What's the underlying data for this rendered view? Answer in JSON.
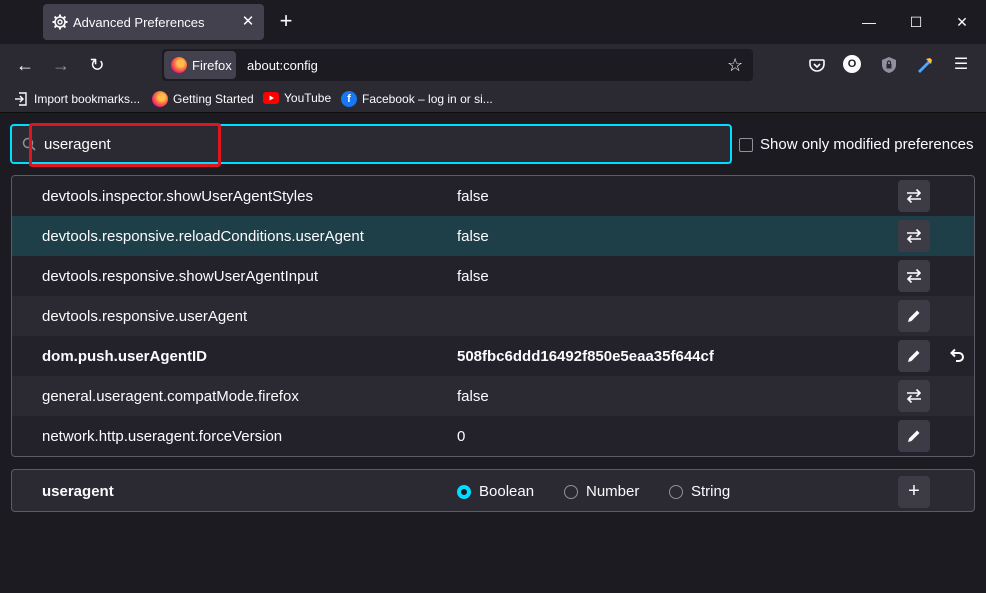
{
  "tab": {
    "title": "Advanced Preferences",
    "close": "✕"
  },
  "newtab": "+",
  "window_controls": {
    "minimize": "—",
    "maximize": "☐",
    "close": "✕"
  },
  "nav": {
    "back": "←",
    "forward": "→",
    "reload": "↻"
  },
  "urlbar": {
    "identity_label": "Firefox",
    "url": "about:config",
    "star": "☆"
  },
  "toolbar": {
    "account_letter": "O",
    "menu": "☰"
  },
  "bookmarks": [
    {
      "label": "Import bookmarks...",
      "icon": "import-icon"
    },
    {
      "label": "Getting Started",
      "icon": "firefox-icon"
    },
    {
      "label": "YouTube",
      "icon": "youtube-icon"
    },
    {
      "label": "Facebook – log in or si...",
      "icon": "facebook-icon"
    }
  ],
  "search": {
    "value": "useragent"
  },
  "show_modified_label": "Show only modified preferences",
  "prefs": [
    {
      "name": "devtools.inspector.showUserAgentStyles",
      "value": "false",
      "action": "toggle"
    },
    {
      "name": "devtools.responsive.reloadConditions.userAgent",
      "value": "false",
      "action": "toggle"
    },
    {
      "name": "devtools.responsive.showUserAgentInput",
      "value": "false",
      "action": "toggle"
    },
    {
      "name": "devtools.responsive.userAgent",
      "value": "",
      "action": "edit"
    },
    {
      "name": "dom.push.userAgentID",
      "value": "508fbc6ddd16492f850e5eaa35f644cf",
      "action": "edit",
      "modified": true
    },
    {
      "name": "general.useragent.compatMode.firefox",
      "value": "false",
      "action": "toggle"
    },
    {
      "name": "network.http.useragent.forceVersion",
      "value": "0",
      "action": "edit"
    }
  ],
  "add_row": {
    "name": "useragent",
    "types": [
      "Boolean",
      "Number",
      "String"
    ],
    "selected": "Boolean",
    "add": "+"
  },
  "colors": {
    "accent": "#00ddff",
    "highlight_box": "#e0141e",
    "selected_row": "#1f3f48"
  }
}
